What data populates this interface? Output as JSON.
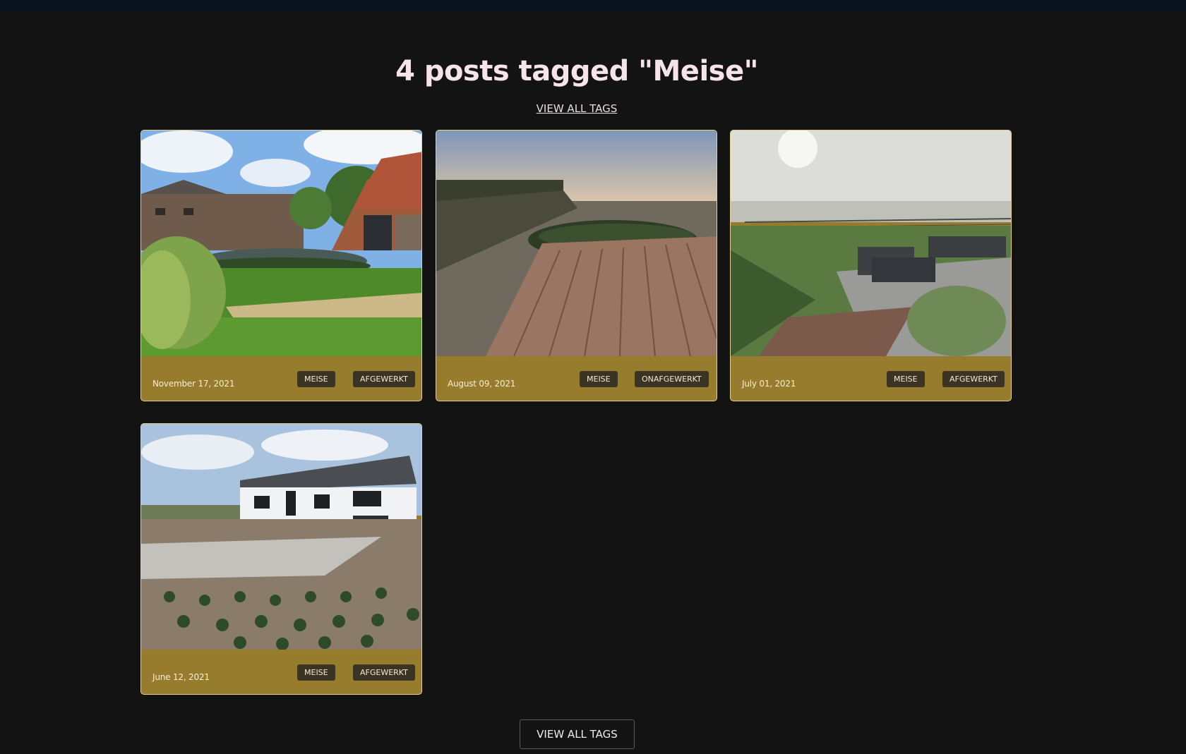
{
  "page": {
    "title": "4 posts tagged \"Meise\"",
    "view_all_link": "VIEW ALL TAGS",
    "view_all_button": "VIEW ALL TAGS"
  },
  "posts": [
    {
      "date": "November 17, 2021",
      "tags": [
        "MEISE",
        "AFGEWERKT"
      ],
      "image": "garden-pond-photo"
    },
    {
      "date": "August 09, 2021",
      "tags": [
        "MEISE",
        "ONAFGEWERKT"
      ],
      "image": "wooden-deck-photo"
    },
    {
      "date": "July 01, 2021",
      "tags": [
        "MEISE",
        "AFGEWERKT"
      ],
      "image": "foggy-terrace-photo"
    },
    {
      "date": "June 12, 2021",
      "tags": [
        "MEISE",
        "AFGEWERKT"
      ],
      "image": "white-house-photo"
    }
  ],
  "colors": {
    "background": "#131313",
    "card": "#977c2d",
    "tag": "#3b3424",
    "title": "#f6e4ea"
  }
}
